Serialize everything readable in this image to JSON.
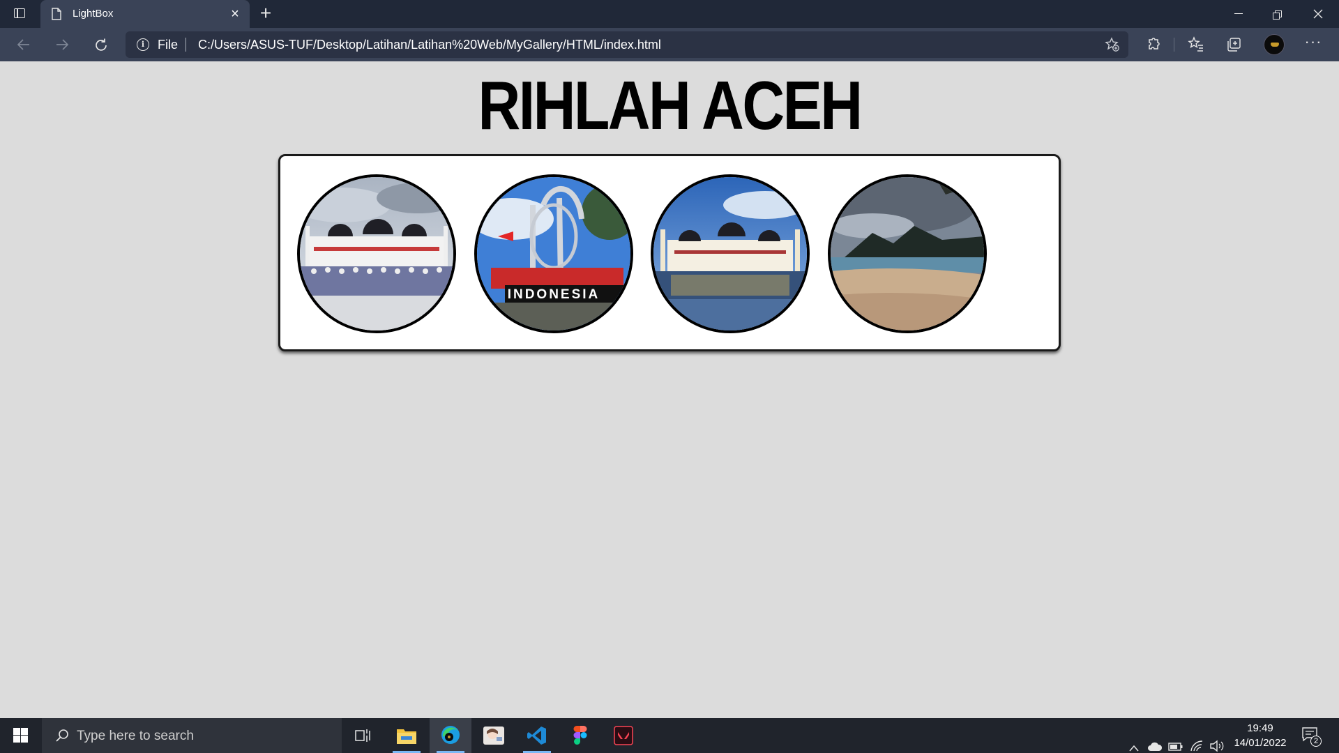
{
  "browser": {
    "tab": {
      "title": "LightBox",
      "close_icon": "close-icon",
      "page_icon": "page-icon"
    },
    "new_tab_icon": "plus-icon",
    "window_controls": [
      "minimize-icon",
      "restore-icon",
      "close-icon"
    ],
    "address": {
      "scheme_label": "File",
      "url": "C:/Users/ASUS-TUF/Desktop/Latihan/Latihan%20Web/MyGallery/HTML/index.html"
    },
    "toolbar_icons": [
      "back-icon",
      "forward-icon",
      "refresh-icon",
      "info-icon",
      "add-favorite-icon",
      "extensions-icon",
      "favorites-icon",
      "collections-icon",
      "profile-avatar",
      "more-icon"
    ]
  },
  "page": {
    "title": "RIHLAH ACEH",
    "gallery": {
      "images": [
        {
          "name": "baiturrahman-mosque-group"
        },
        {
          "name": "kilometer-zero-indonesia"
        },
        {
          "name": "baiturrahman-mosque-reflection"
        },
        {
          "name": "aceh-beach"
        }
      ]
    }
  },
  "taskbar": {
    "search_placeholder": "Type here to search",
    "apps": [
      "task-view-icon",
      "file-explorer-icon",
      "edge-icon",
      "photo-app-icon",
      "vscode-icon",
      "figma-icon",
      "valorant-icon"
    ],
    "time": "19:49",
    "date": "14/01/2022",
    "notification_count": "2"
  },
  "colors": {
    "titlebar": "#202838",
    "toolbar": "#3a4357",
    "page_background": "#dcdcdc",
    "taskbar": "#20242c"
  }
}
